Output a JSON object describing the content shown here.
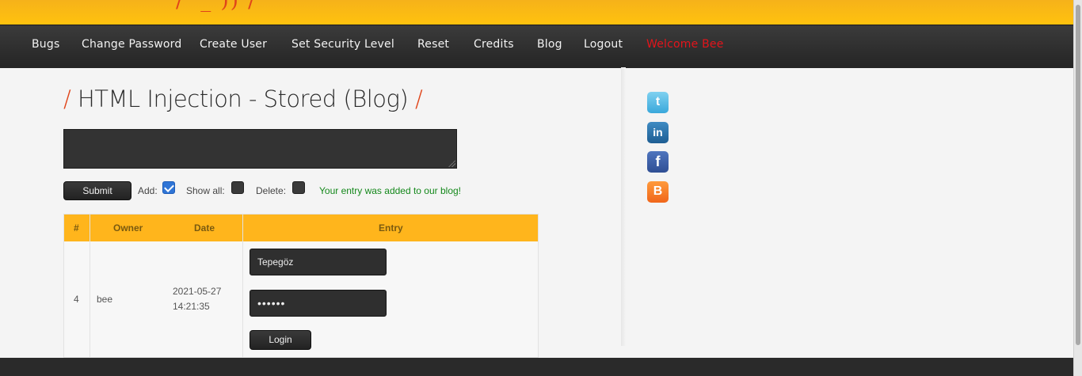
{
  "nav": {
    "items": [
      "Bugs",
      "Change Password",
      "Create User",
      "Set Security Level",
      "Reset",
      "Credits",
      "Blog",
      "Logout"
    ],
    "welcome": "Welcome Bee"
  },
  "page": {
    "title": "HTML Injection - Stored (Blog)",
    "slash": "/"
  },
  "form": {
    "submit_label": "Submit",
    "add_label": "Add:",
    "add_checked": true,
    "show_all_label": "Show all:",
    "show_all_checked": false,
    "delete_label": "Delete:",
    "delete_checked": false,
    "message": "Your entry was added to our blog!"
  },
  "table": {
    "headers": [
      "#",
      "Owner",
      "Date",
      "Entry"
    ],
    "rows": [
      {
        "id": "4",
        "owner": "bee",
        "date": "2021-05-27",
        "time": "14:21:35",
        "entry": {
          "username_value": "Tepegöz",
          "password_value": "••••••",
          "login_label": "Login"
        }
      }
    ]
  },
  "social": {
    "icons": [
      "twitter-icon",
      "linkedin-icon",
      "facebook-icon",
      "blogger-icon"
    ],
    "glyphs": [
      "t",
      "in",
      "f",
      "B"
    ]
  },
  "colors": {
    "accent": "#ffb51c",
    "nav_bg": "#2c2c2c",
    "welcome": "#e3141b",
    "success": "#14881b"
  }
}
